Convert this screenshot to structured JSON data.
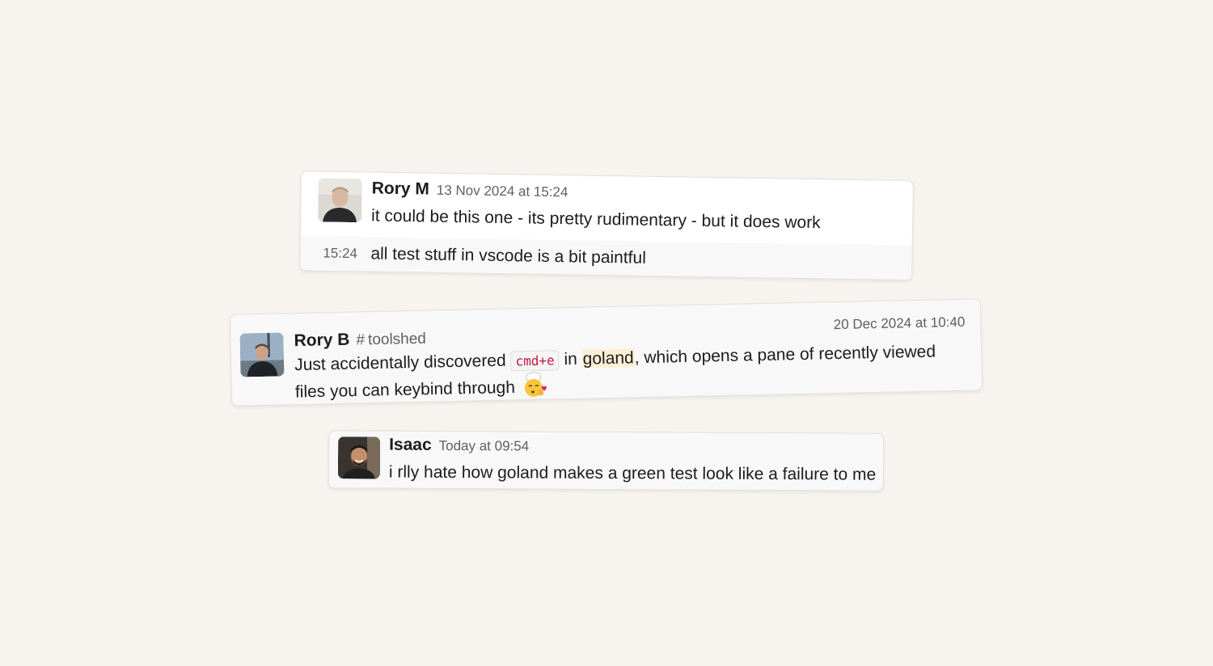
{
  "messages": [
    {
      "author": "Rory M",
      "timestamp": "13 Nov 2024 at 15:24",
      "text": "it could be this one - its pretty rudimentary - but it does work",
      "followup": {
        "time": "15:24",
        "text": "all test stuff in vscode is a bit paintful"
      }
    },
    {
      "author": "Rory B",
      "channel_hash": "#",
      "channel": "toolshed",
      "timestamp": "20 Dec 2024 at 10:40",
      "text_before_code": "Just accidentally discovered ",
      "code": "cmd+e",
      "text_after_code": " in ",
      "highlight": "goland",
      "text_end": ", which opens a pane of recently viewed files you can keybind through ",
      "emoji": "chef-kiss-emoji"
    },
    {
      "author": "Isaac",
      "timestamp": "Today at 09:54",
      "text": "i rlly hate how goland makes a green test look like a failure to me"
    }
  ],
  "colors": {
    "background": "#f7f4ef",
    "code_text": "#c0143c",
    "highlight": "#fcefd6"
  }
}
